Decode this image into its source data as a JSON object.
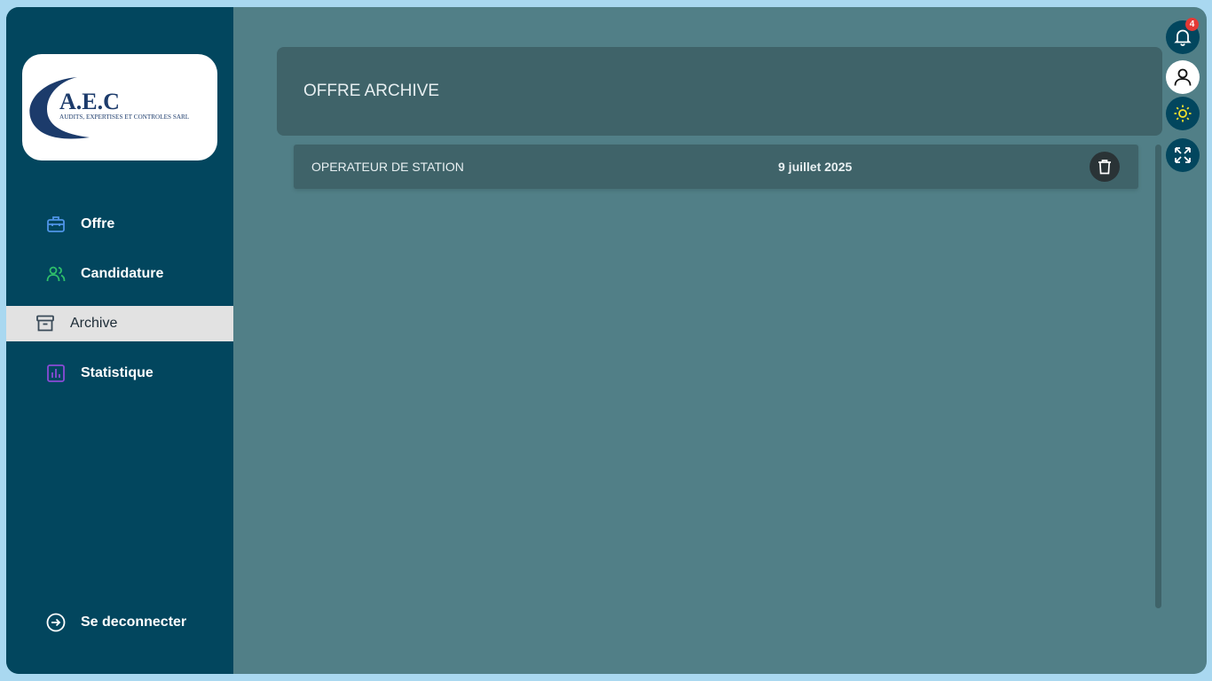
{
  "brand": {
    "logo_title": "A.E.C",
    "logo_subtitle": "AUDITS, EXPERTISES ET CONTROLES SARL"
  },
  "sidebar": {
    "items": [
      {
        "label": "Offre",
        "icon": "briefcase-icon",
        "active": false
      },
      {
        "label": "Candidature",
        "icon": "users-icon",
        "active": false
      },
      {
        "label": "Archive",
        "icon": "archive-icon",
        "active": true
      },
      {
        "label": "Statistique",
        "icon": "chart-icon",
        "active": false
      }
    ],
    "logout_label": "Se deconnecter"
  },
  "main": {
    "title": "OFFRE ARCHIVE",
    "rows": [
      {
        "job": "OPERATEUR DE STATION",
        "date": "9 juillet 2025"
      }
    ]
  },
  "topbar": {
    "notification_count": "4"
  },
  "colors": {
    "sidebar_bg": "#02465e",
    "main_bg": "#517f87",
    "card_bg": "#3f6369",
    "active_item_bg": "#e2e2e2"
  }
}
